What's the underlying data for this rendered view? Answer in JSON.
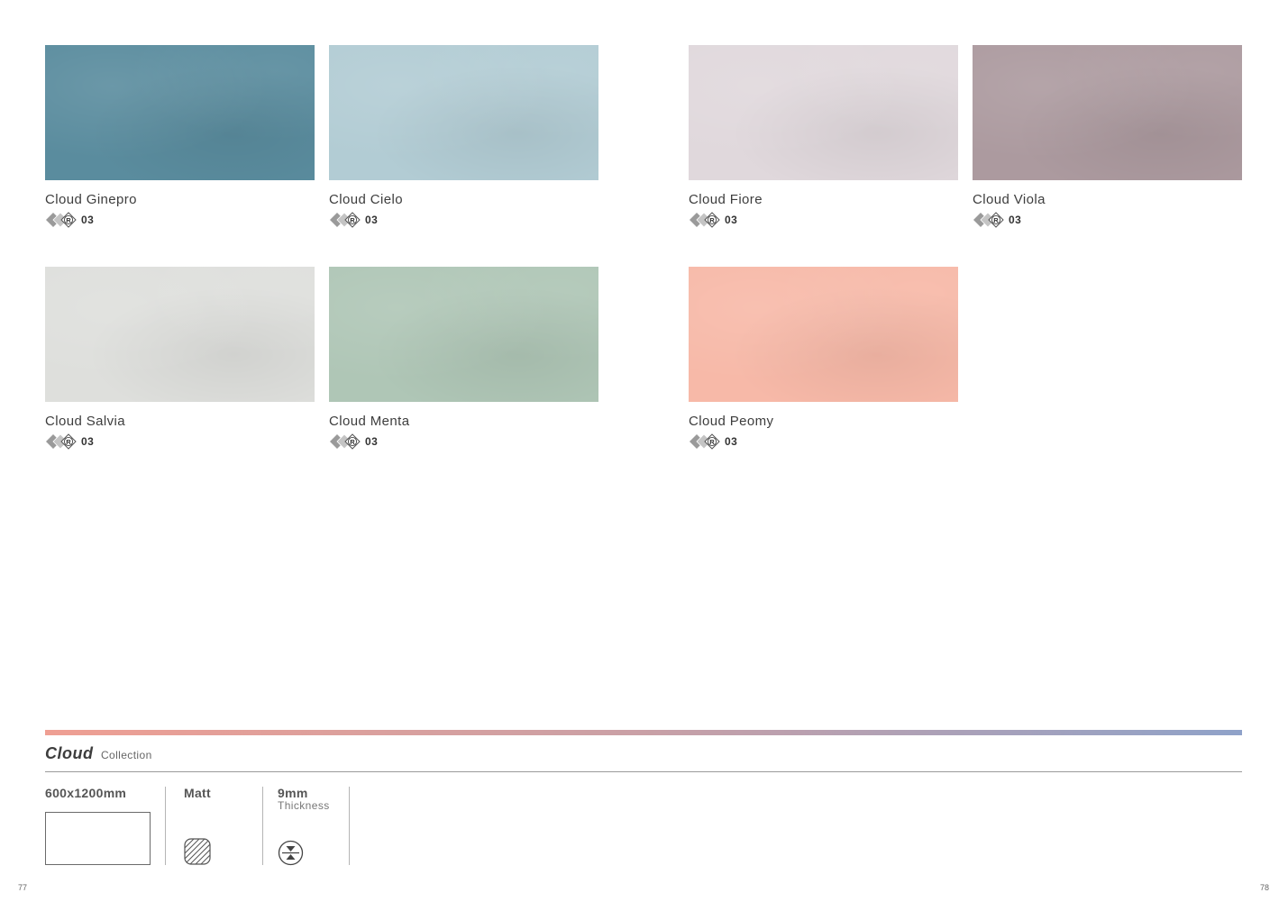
{
  "tiles": [
    {
      "name": "Cloud Ginepro",
      "rectified": "03",
      "color": "#5a8c9e"
    },
    {
      "name": "Cloud Cielo",
      "rectified": "03",
      "color": "#b2ccd4"
    },
    {
      "name": "Cloud Fiore",
      "rectified": "03",
      "color": "#e0d8dc"
    },
    {
      "name": "Cloud Viola",
      "rectified": "03",
      "color": "#ac9a9f"
    },
    {
      "name": "Cloud Salvia",
      "rectified": "03",
      "color": "#dedfdc"
    },
    {
      "name": "Cloud Menta",
      "rectified": "03",
      "color": "#afc6b6"
    },
    {
      "name": "Cloud Peomy",
      "rectified": "03",
      "color": "#f7b9a8"
    }
  ],
  "footer": {
    "brand": "Cloud",
    "brand_sub": "Collection",
    "size": "600x1200mm",
    "finish": "Matt",
    "thickness": "9mm",
    "thickness_label": "Thickness",
    "gradient_colors": [
      "#ef9f93",
      "#c9a0a6",
      "#8fa2c9"
    ]
  },
  "pages": {
    "left": "77",
    "right": "78"
  }
}
